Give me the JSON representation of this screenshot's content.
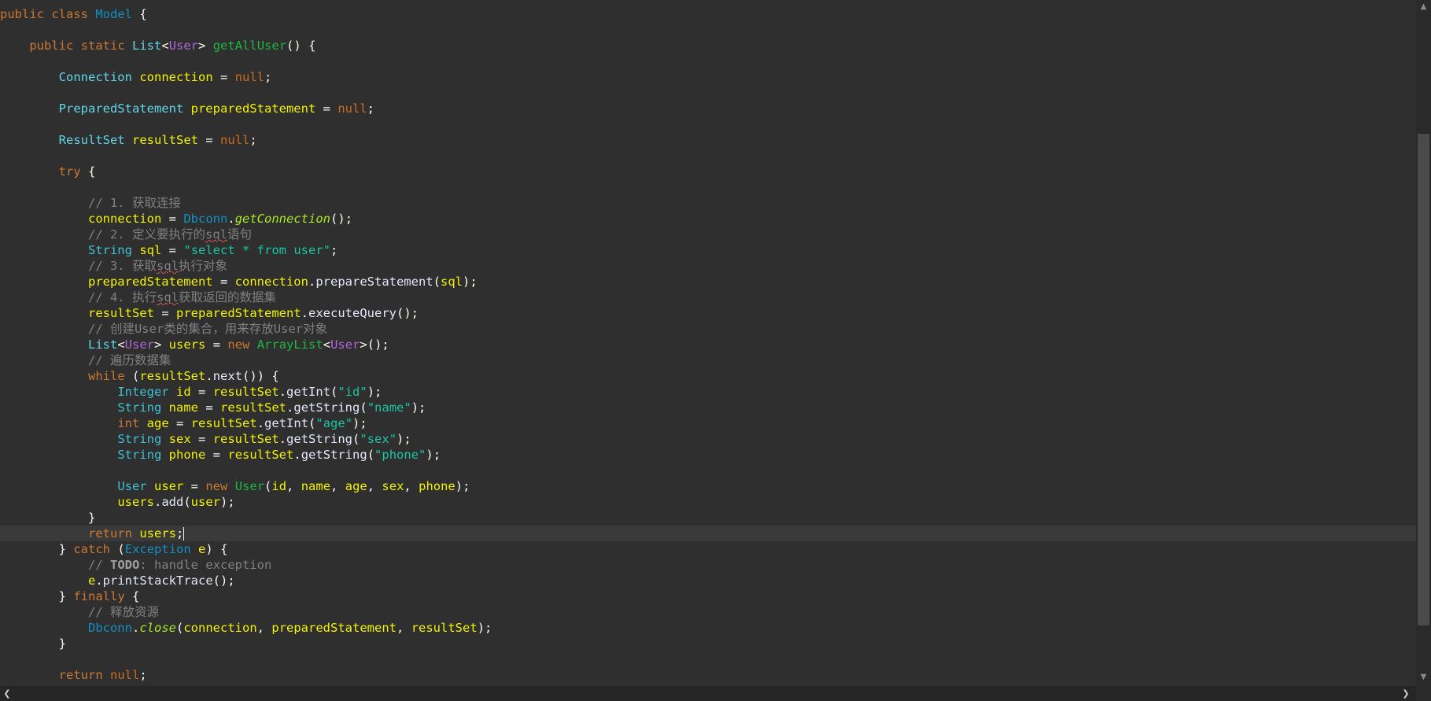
{
  "editor": {
    "language": "java",
    "cursor_line": 34,
    "code_lines": [
      "public class Model {",
      "",
      "    public static List<User> getAllUser() {",
      "",
      "        Connection connection = null;",
      "",
      "        PreparedStatement preparedStatement = null;",
      "",
      "        ResultSet resultSet = null;",
      "",
      "        try {",
      "",
      "            // 1. 获取连接",
      "            connection = Dbconn.getConnection();",
      "            // 2. 定义要执行的sql语句",
      "            String sql = \"select * from user\";",
      "            // 3. 获取sql执行对象",
      "            preparedStatement = connection.prepareStatement(sql);",
      "            // 4. 执行sql获取返回的数据集",
      "            resultSet = preparedStatement.executeQuery();",
      "            // 创建User类的集合，用来存放User对象",
      "            List<User> users = new ArrayList<User>();",
      "            // 遍历数据集",
      "            while (resultSet.next()) {",
      "                Integer id = resultSet.getInt(\"id\");",
      "                String name = resultSet.getString(\"name\");",
      "                int age = resultSet.getInt(\"age\");",
      "                String sex = resultSet.getString(\"sex\");",
      "                String phone = resultSet.getString(\"phone\");",
      "",
      "                User user = new User(id, name, age, sex, phone);",
      "                users.add(user);",
      "            }",
      "            return users;",
      "        } catch (Exception e) {",
      "            // TODO: handle exception",
      "            e.printStackTrace();",
      "        } finally {",
      "            // 释放资源",
      "            Dbconn.close(connection, preparedStatement, resultSet);",
      "        }",
      "",
      "        return null;"
    ]
  },
  "scrollbars": {
    "up_icon": "▲",
    "down_icon": "▼",
    "left_icon": "❮",
    "right_icon": "❯"
  },
  "colors": {
    "background": "#2f2f2f",
    "keyword": "#cc7832",
    "type": "#3ec1d3",
    "class": "#1290c3",
    "variable": "#f2f200",
    "method": "#1eb540",
    "string": "#17c6a3",
    "comment": "#808080",
    "generic": "#b166da"
  }
}
